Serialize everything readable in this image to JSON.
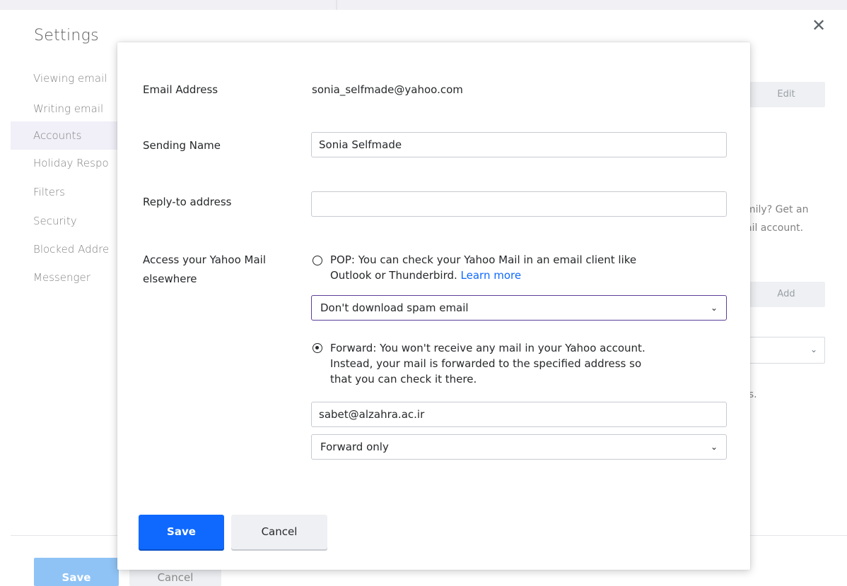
{
  "background": {
    "title": "Settings",
    "nav": [
      "Viewing email",
      "Writing email",
      "Accounts",
      "Holiday Respo",
      "Filters",
      "Security",
      "Blocked Addre",
      "Messenger"
    ],
    "edit_label": "Edit",
    "add_label": "Add",
    "promo_line1": "mily? Get an",
    "promo_line2": "ail account.",
    "tail_text": "ls.",
    "save_label": "Save",
    "cancel_label": "Cancel"
  },
  "modal": {
    "email_label": "Email Address",
    "email_value": "sonia_selfmade@yahoo.com",
    "sending_name_label": "Sending Name",
    "sending_name_value": "Sonia Selfmade",
    "reply_to_label": "Reply-to address",
    "reply_to_value": "",
    "access_label_line1": "Access your Yahoo Mail",
    "access_label_line2": "elsewhere",
    "pop_line1": "POP: You can check your Yahoo Mail in an email client like",
    "pop_line2": "Outlook or Thunderbird.",
    "learn_more": "Learn more",
    "pop_select": "Don't download spam email",
    "forward_line1": "Forward: You won't receive any mail in your Yahoo account.",
    "forward_line2": "Instead, your mail is forwarded to the specified address so",
    "forward_line3": "that you can check it there.",
    "forward_address": "sabet@alzahra.ac.ir",
    "forward_select": "Forward only",
    "pop_checked": false,
    "forward_checked": true,
    "save_label": "Save",
    "cancel_label": "Cancel"
  },
  "icons": {
    "close": "close-icon",
    "chevron": "chevron-down-icon"
  },
  "colors": {
    "primary": "#0f69ff",
    "link": "#0f69ff",
    "focus": "#5c3d99",
    "active_nav": "#f1eff8"
  }
}
